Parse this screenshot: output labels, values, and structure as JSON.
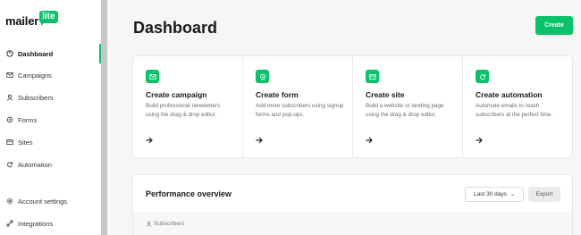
{
  "brand": {
    "word": "mailer",
    "badge": "lite",
    "color": "#09c269"
  },
  "sidebar": {
    "items": [
      {
        "label": "Dashboard",
        "icon": "dashboard-icon",
        "active": true
      },
      {
        "label": "Campaigns",
        "icon": "mail-icon"
      },
      {
        "label": "Subscribers",
        "icon": "user-icon"
      },
      {
        "label": "Forms",
        "icon": "forms-icon"
      },
      {
        "label": "Sites",
        "icon": "sites-icon"
      },
      {
        "label": "Automation",
        "icon": "automation-icon"
      },
      {
        "label": "Account settings",
        "icon": "settings-icon"
      },
      {
        "label": "Integrations",
        "icon": "integrations-icon"
      }
    ]
  },
  "header": {
    "title": "Dashboard",
    "create_label": "Create"
  },
  "cards": [
    {
      "title": "Create campaign",
      "desc": "Build professional newsletters using the drag & drop editor.",
      "icon": "mail-icon"
    },
    {
      "title": "Create form",
      "desc": "Add more subscribers using signup forms and pop-ups.",
      "icon": "forms-icon"
    },
    {
      "title": "Create site",
      "desc": "Build a website or landing page using the drag & drop editor.",
      "icon": "sites-icon"
    },
    {
      "title": "Create automation",
      "desc": "Automate emails to reach subscribers at the perfect time.",
      "icon": "automation-icon"
    }
  ],
  "performance": {
    "title": "Performance overview",
    "range": "Last 30 days",
    "export_label": "Export",
    "tab_label": "Subscribers"
  }
}
